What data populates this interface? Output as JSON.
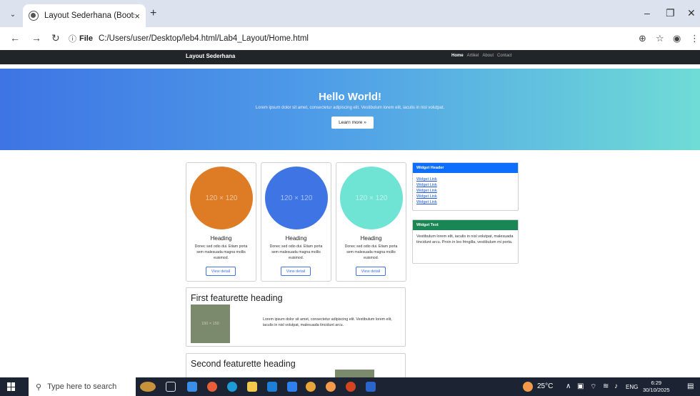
{
  "browser": {
    "tab_title": "Layout Sederhana (Bootstrap)",
    "tab_close": "×",
    "new_tab": "+",
    "url_scheme": "File",
    "url": "C:/Users/user/Desktop/leb4.html/Lab4_Layout/Home.html"
  },
  "page": {
    "brand": "Layout Sederhana",
    "nav": [
      "Home",
      "Artikel",
      "About",
      "Contact"
    ],
    "hero": {
      "title": "Hello World!",
      "text": "Lorem ipsum dolor sit amet, consectetur adipiscing elit. Vestibulum lorem elit, iaculis in nisl volutpat.",
      "button": "Learn more »"
    },
    "cards": [
      {
        "placeholder": "120 × 120",
        "heading": "Heading",
        "text": "Donec sed odio dui. Etiam porta sem malesuada magna mollis euismod.",
        "button": "View detail",
        "color": "#de7c26"
      },
      {
        "placeholder": "120 × 120",
        "heading": "Heading",
        "text": "Donec sed odio dui. Etiam porta sem malesuada magna mollis euismod.",
        "button": "View detail",
        "color": "#3e74e4"
      },
      {
        "placeholder": "120 × 120",
        "heading": "Heading",
        "text": "Donec sed odio dui. Etiam porta sem malesuada magna mollis euismod.",
        "button": "View detail",
        "color": "#70e4d4"
      }
    ],
    "widget_links": {
      "header": "Widget Header",
      "links": [
        "Widget Link",
        "Widget Link",
        "Widget Link",
        "Widget Link",
        "Widget Link"
      ]
    },
    "widget_text": {
      "header": "Widget Text",
      "text": "Vestibulum lorem elit, iaculis in nisl volutpat, malesuada tincidunt arcu. Proin in leo fringilla, vestibulum mi porta."
    },
    "featurettes": [
      {
        "heading": "First featurette heading",
        "placeholder": "150 × 150",
        "text": "Lorem ipsum dolor sit amet, consectetur adipiscing elit. Vestibulum lorem elit, iaculis in nisl volutpat, malesuada tincidunt arcu."
      },
      {
        "heading": "Second featurette heading"
      }
    ]
  },
  "taskbar": {
    "search_placeholder": "Type here to search",
    "weather": "25°C",
    "language": "ENG",
    "time": "6:29",
    "date": "30/10/2025"
  },
  "colors": {
    "widget_blue": "#0d6efd",
    "widget_green": "#198754",
    "navbar": "#212529"
  }
}
